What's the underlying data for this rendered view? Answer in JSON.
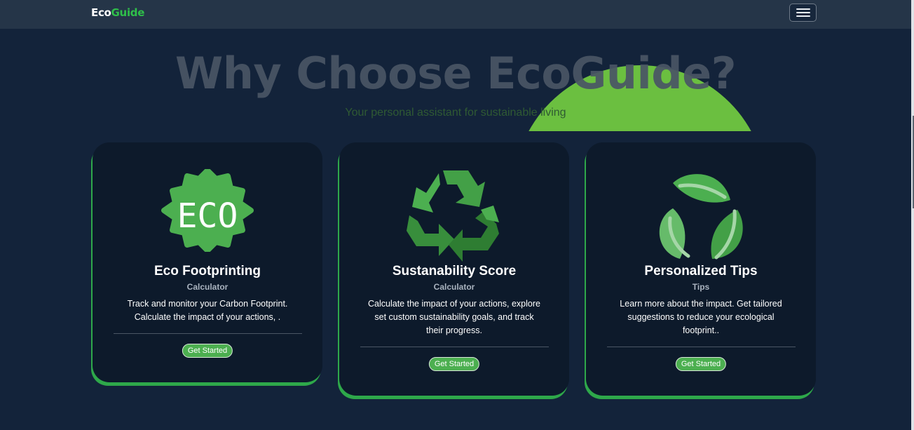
{
  "navbar": {
    "brand_part1": "Eco",
    "brand_part2": "Guide",
    "menu_icon": "hamburger-icon"
  },
  "hero": {
    "title": "Why Choose EcoGuide?",
    "subtitle": "Your personal assistant for sustainable living"
  },
  "cards": [
    {
      "icon": "eco-badge-icon",
      "icon_text": "ECO",
      "title": "Eco Footprinting",
      "subtitle": "Calculator",
      "description_line1": "Track  and monitor your Carbon Footprint.",
      "description_line2": "Calculate the impact of your actions, .",
      "button_label": "Get Started"
    },
    {
      "icon": "recycle-icon",
      "title": "Sustanability Score",
      "subtitle": "Calculator",
      "description_line1": "Calculate the impact of your actions, explore",
      "description_line2": "set custom sustainability goals, and track",
      "description_line3": "their progress.",
      "button_label": "Get Started"
    },
    {
      "icon": "leaves-icon",
      "title": "Personalized Tips",
      "subtitle": "Tips",
      "description_line1": "Learn more about the impact. Get tailored",
      "description_line2": "suggestions to reduce your ecological",
      "description_line3": "footprint..",
      "button_label": "Get Started"
    }
  ],
  "colors": {
    "page_background": "#13233a",
    "navbar_background": "#253548",
    "card_background": "#0d1a2b",
    "accent_green": "#2ea84a",
    "button_green": "#4caf50",
    "brand_green": "#2fbf4a"
  }
}
